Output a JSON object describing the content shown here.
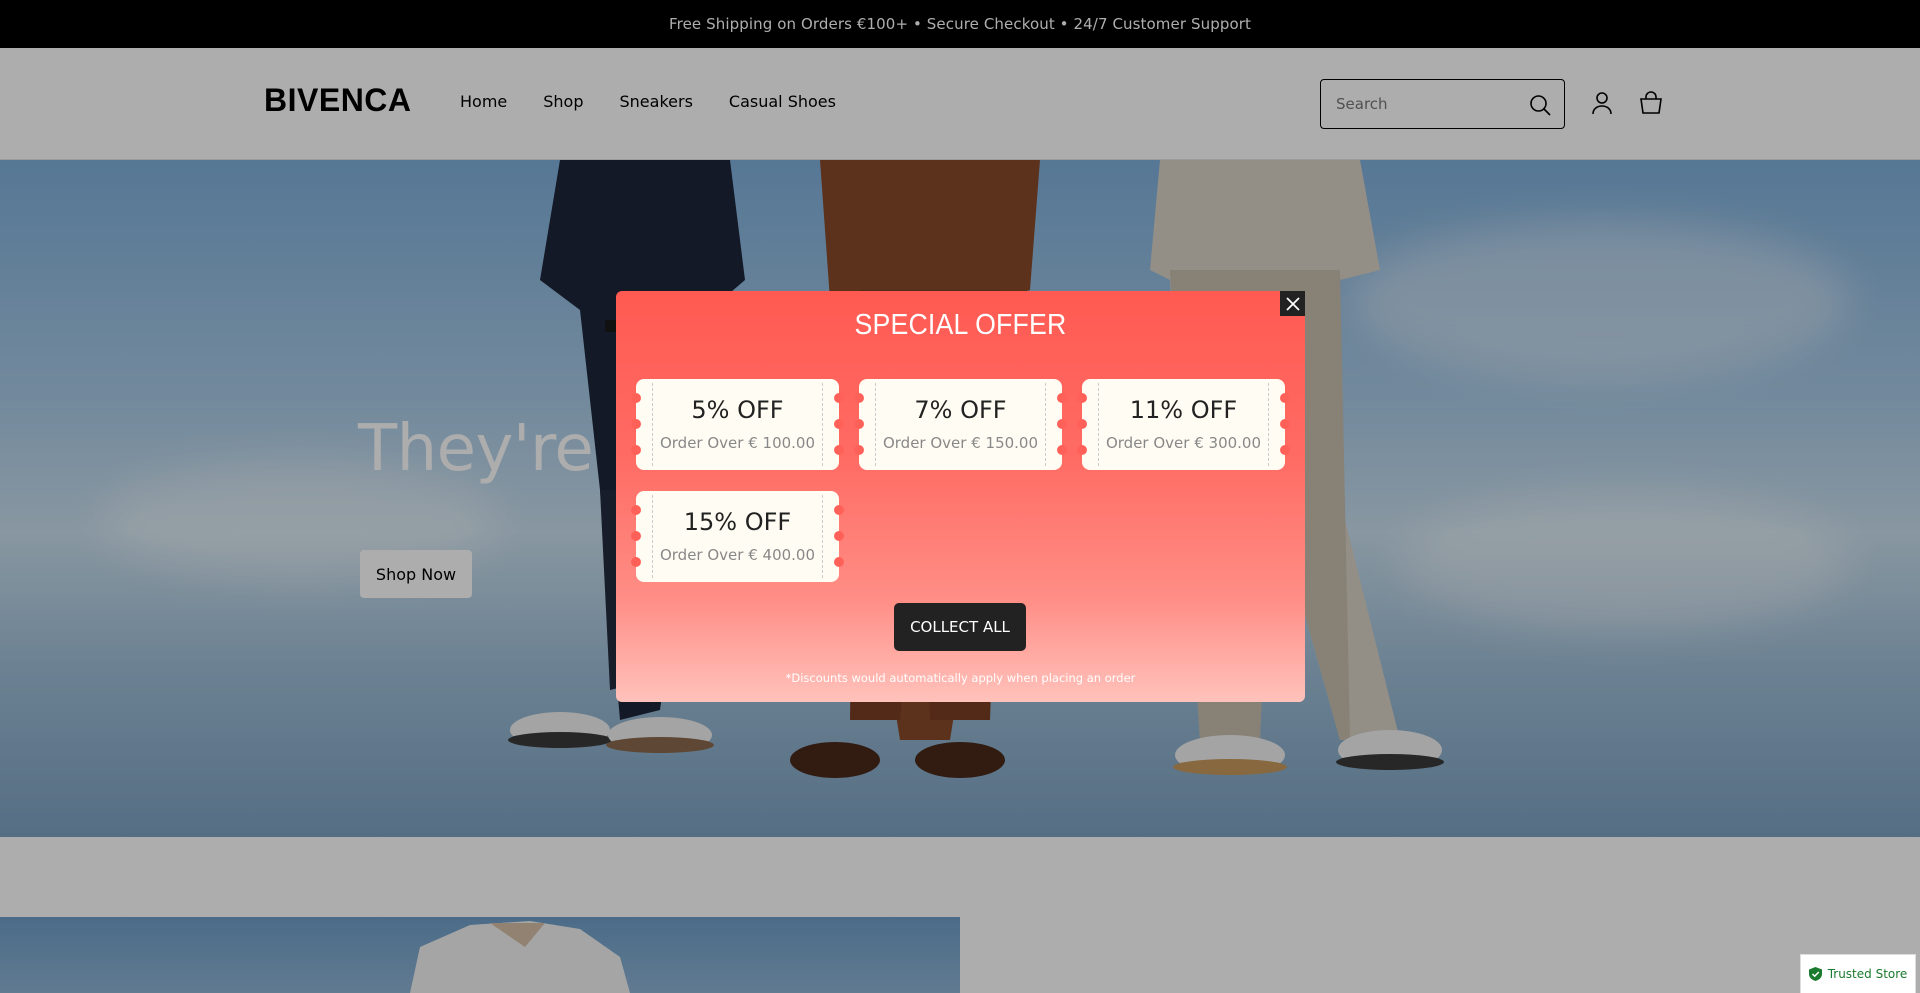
{
  "announcement": "Free Shipping on Orders €100+ • Secure Checkout • 24/7 Customer Support",
  "header": {
    "logo": "BIVENCA",
    "nav": [
      "Home",
      "Shop",
      "Sneakers",
      "Casual Shoes"
    ],
    "search_placeholder": "Search",
    "icons": [
      "search-icon",
      "account-icon",
      "cart-icon"
    ]
  },
  "hero": {
    "title": "They're mo",
    "button": "Shop Now"
  },
  "modal": {
    "title": "SPECIAL OFFER",
    "coupons": [
      {
        "discount": "5% OFF",
        "condition": "Order Over € 100.00"
      },
      {
        "discount": "7% OFF",
        "condition": "Order Over € 150.00"
      },
      {
        "discount": "11% OFF",
        "condition": "Order Over € 300.00"
      },
      {
        "discount": "15% OFF",
        "condition": "Order Over € 400.00"
      }
    ],
    "collect_button": "COLLECT ALL",
    "note": "*Discounts would automatically apply when placing an order"
  },
  "badge": {
    "label": "Trusted Store"
  },
  "colors": {
    "modal_accent": "#ff5a52",
    "button_dark": "#222222",
    "trusted_green": "#1a7a2e"
  }
}
